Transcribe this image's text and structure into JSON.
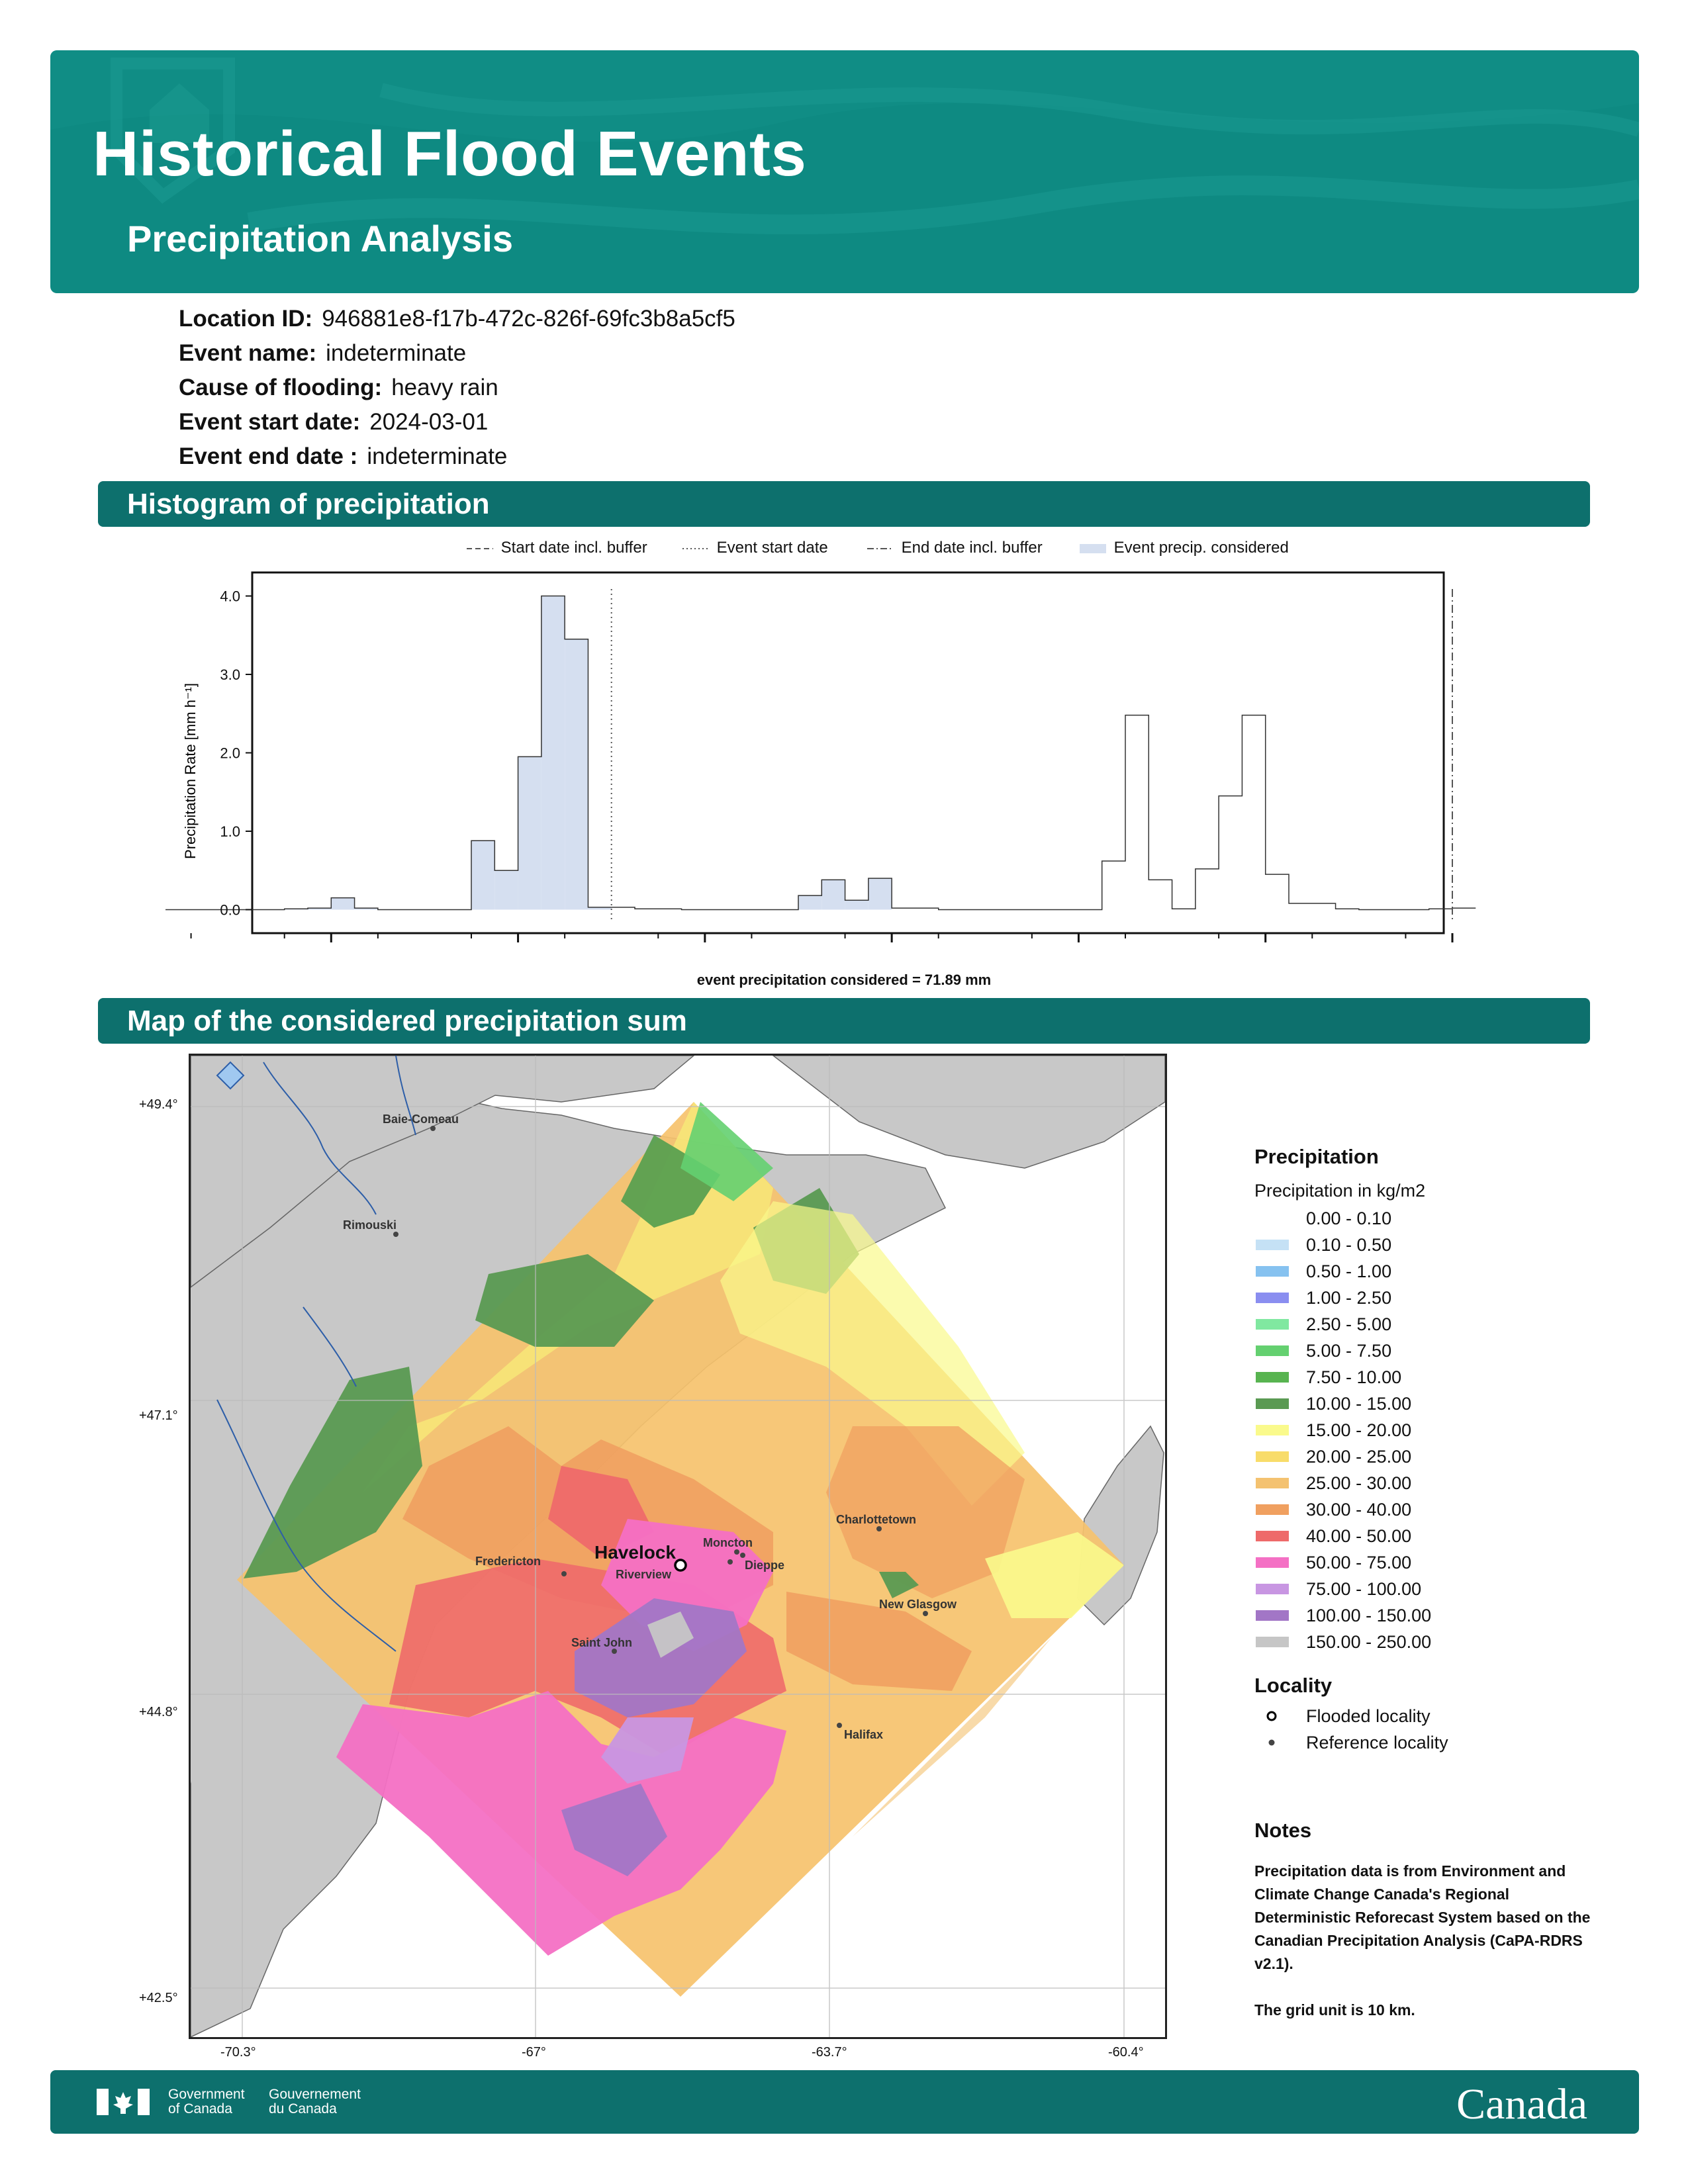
{
  "header": {
    "title": "Historical Flood Events",
    "subtitle": "Precipitation Analysis"
  },
  "info": [
    {
      "label": "Location ID:",
      "value": "946881e8-f17b-472c-826f-69fc3b8a5cf5"
    },
    {
      "label": "Event name:",
      "value": "indeterminate"
    },
    {
      "label": "Cause of flooding:",
      "value": "heavy rain"
    },
    {
      "label": "Event start date:",
      "value": "2024-03-01"
    },
    {
      "label": "Event end date :",
      "value": "indeterminate"
    }
  ],
  "sections": {
    "histogram": "Histogram of precipitation",
    "map": "Map of the considered precipitation sum"
  },
  "chart_data": {
    "type": "bar",
    "ylabel": "Precipitation Rate [mm h⁻¹]",
    "ylim": [
      -0.3,
      4.3
    ],
    "yticks": [
      "0.0",
      "1.0",
      "2.0",
      "3.0",
      "4.0"
    ],
    "legend": [
      {
        "label": "Start date incl. buffer",
        "style": "dashed"
      },
      {
        "label": "Event start date",
        "style": "dotted"
      },
      {
        "label": "End date incl. buffer",
        "style": "dashdot"
      },
      {
        "label": "Event precip. considered",
        "style": "fill"
      }
    ],
    "bin_index": [
      0,
      62
    ],
    "start_buffer_bin": 0,
    "event_start_bin": 20,
    "end_buffer_bin": 56,
    "series": [
      {
        "values": [
          0,
          0,
          0,
          0,
          0,
          0,
          0.01,
          0.02,
          0.15,
          0.02,
          0,
          0,
          0,
          0,
          0.88,
          0.5,
          1.95,
          4.0,
          3.45,
          0.03,
          0.03,
          0.01,
          0.01,
          0,
          0,
          0,
          0,
          0,
          0.18,
          0.38,
          0.12,
          0.4,
          0.02,
          0.02,
          0,
          0,
          0,
          0,
          0,
          0,
          0,
          0.62,
          2.48,
          0.38,
          0.01,
          0.52,
          1.45,
          2.48,
          0.45,
          0.08,
          0.08,
          0.01,
          0,
          0,
          0,
          0.01,
          0.02
        ],
        "considered_bins": [
          [
            0,
            19
          ],
          [
            28,
            31
          ]
        ]
      }
    ],
    "annotation": "event precipitation considered = 71.89 mm"
  },
  "map": {
    "lat_ticks": [
      "+49.4°",
      "+47.1°",
      "+44.8°",
      "+42.5°"
    ],
    "lon_ticks": [
      "-70.3°",
      "-67°",
      "-63.7°",
      "-60.4°"
    ],
    "flooded_locality": "Havelock",
    "reference_localities": [
      "Baie-Comeau",
      "Rimouski",
      "Fredericton",
      "Moncton",
      "Dieppe",
      "Riverview",
      "Saint John",
      "Charlottetown",
      "New Glasgow",
      "Halifax"
    ]
  },
  "legend": {
    "title": "Precipitation",
    "subtitle": "Precipitation in kg/m2",
    "classes": [
      {
        "label": "0.00 - 0.10",
        "color": "#ffffff"
      },
      {
        "label": "0.10 - 0.50",
        "color": "#c5e1f5"
      },
      {
        "label": "0.50 - 1.00",
        "color": "#86c2f0"
      },
      {
        "label": "1.00 - 2.50",
        "color": "#8a8ef0"
      },
      {
        "label": "2.50 - 5.00",
        "color": "#80e8a0"
      },
      {
        "label": "5.00 - 7.50",
        "color": "#64d070"
      },
      {
        "label": "7.50 - 10.00",
        "color": "#58b450"
      },
      {
        "label": "10.00 - 15.00",
        "color": "#5a9a52"
      },
      {
        "label": "15.00 - 20.00",
        "color": "#fafa8c"
      },
      {
        "label": "20.00 - 25.00",
        "color": "#f8dc6a"
      },
      {
        "label": "25.00 - 30.00",
        "color": "#f4c270"
      },
      {
        "label": "30.00 - 40.00",
        "color": "#f0a060"
      },
      {
        "label": "40.00 - 50.00",
        "color": "#ee6a6a"
      },
      {
        "label": "50.00 - 75.00",
        "color": "#f470c4"
      },
      {
        "label": "75.00 - 100.00",
        "color": "#c896e2"
      },
      {
        "label": "100.00 - 150.00",
        "color": "#a276c6"
      },
      {
        "label": "150.00 - 250.00",
        "color": "#c6c6c6"
      }
    ],
    "locality_title": "Locality",
    "flooded_label": "Flooded locality",
    "reference_label": "Reference locality"
  },
  "notes": {
    "title": "Notes",
    "text": "Precipitation data is from Environment and Climate Change Canada's Regional Deterministic Reforecast System based on the Canadian Precipitation Analysis (CaPA-RDRS v2.1).",
    "grid": "The grid unit is 10 km."
  },
  "footer": {
    "gov_en_1": "Government",
    "gov_en_2": "of Canada",
    "gov_fr_1": "Gouvernement",
    "gov_fr_2": "du Canada",
    "wordmark": "Canada"
  }
}
